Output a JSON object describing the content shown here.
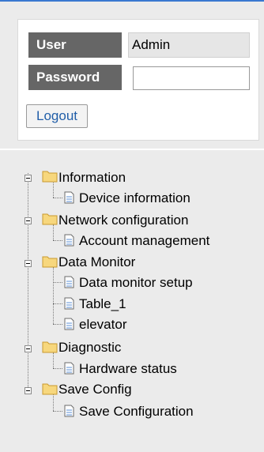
{
  "login": {
    "user_label": "User",
    "user_value": "Admin",
    "password_label": "Password",
    "password_value": "",
    "logout_label": "Logout"
  },
  "tree": {
    "information": "Information",
    "device_information": "Device information",
    "network_configuration": "Network configuration",
    "account_management": "Account management",
    "data_monitor": "Data Monitor",
    "data_monitor_setup": "Data monitor setup",
    "table_1": "Table_1",
    "elevator": "elevator",
    "diagnostic": "Diagnostic",
    "hardware_status": "Hardware status",
    "save_config": "Save Config",
    "save_configuration": "Save Configuration"
  },
  "icons": {
    "folder": "folder-icon",
    "document": "document-icon",
    "toggle": "collapse-toggle-icon"
  },
  "colors": {
    "top_accent": "#3a78d0",
    "label_bg": "#666666",
    "folder_fill": "#f7d77d",
    "logout_text": "#215ea8"
  }
}
